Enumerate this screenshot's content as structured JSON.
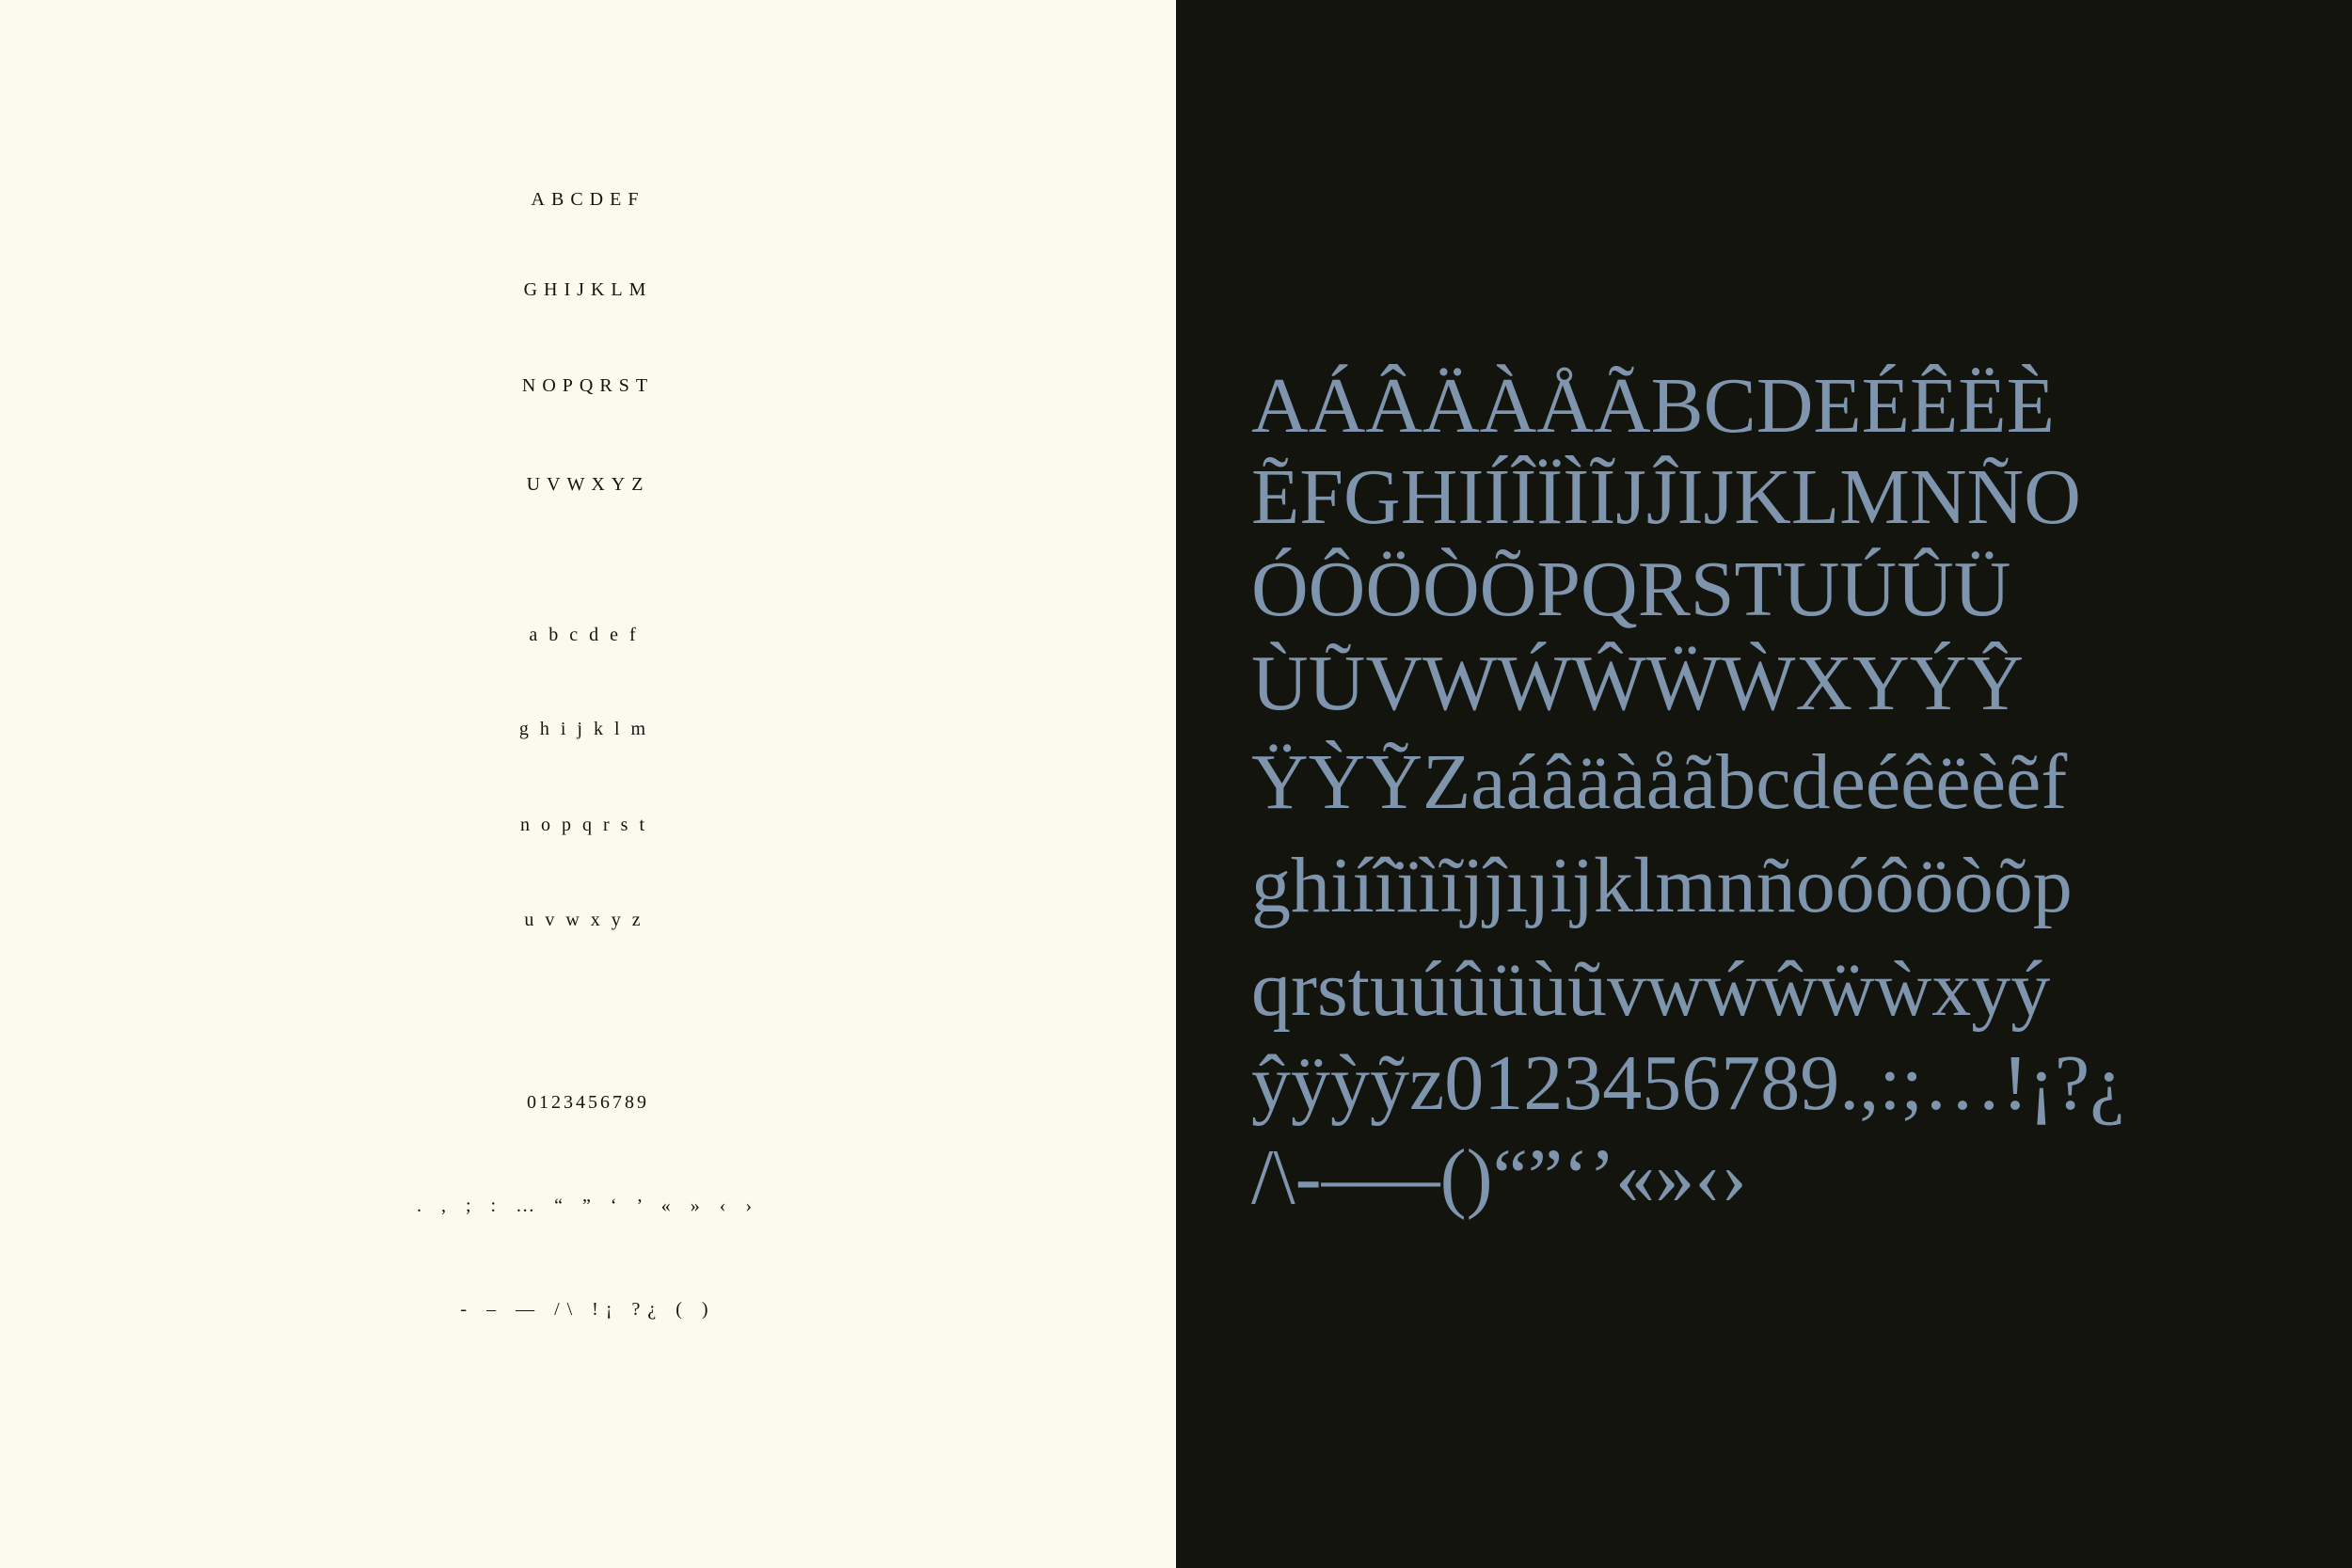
{
  "specimen": {
    "left": {
      "uppercase": [
        "ABCDEF",
        "GHIJKLM",
        "NOPQRST",
        "UVWXYZ"
      ],
      "lowercase": [
        "abcdef",
        "ghijklm",
        "nopqrst",
        "uvwxyz"
      ],
      "figures": "0123456789",
      "punctuation_1": ". , ; : … “ ” ‘ ’ « » ‹ ›",
      "punctuation_2": "- – — /\\ !¡ ?¿ ( )"
    },
    "right": {
      "glyph_lines": [
        "AÁÂÄÀÅÃBCDEÉÊËÈ",
        "ẼFGHIÍÎÏÌĨJĴIJKLMNÑO",
        "ÓÔÖÒÕPQRSTUÚÛÜ",
        "ÙŨVWẂŴẄẀXYÝŶ",
        "ŸỲỸZaáâäàåãbcdeéêëèẽf",
        "ghiíîïìĩjĵıȷijklmnñoóôöòõp",
        "qrstuúûüùũvwẃŵẅẁxyý",
        "ŷÿỳỹz0123456789.,:;…!¡?¿",
        "/\\-–—()“”‘’«»‹›"
      ]
    },
    "colors": {
      "left_background": "#fcfaee",
      "left_text": "#14140f",
      "right_background": "#13140d",
      "right_text": "#7e95ad"
    }
  }
}
